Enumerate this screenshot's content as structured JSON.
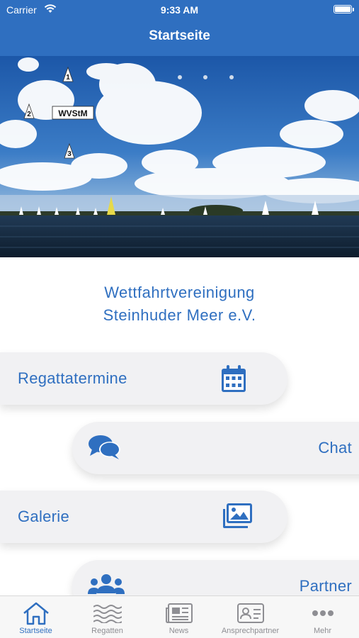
{
  "status_bar": {
    "carrier": "Carrier",
    "time": "9:33 AM"
  },
  "nav": {
    "title": "Startseite"
  },
  "hero": {
    "banner_label": "WVStM",
    "buoys": [
      "1",
      "2",
      "3"
    ]
  },
  "club": {
    "line1": "Wettfahrtvereinigung",
    "line2": "Steinhuder Meer e.V."
  },
  "menu": [
    {
      "label": "Regattatermine",
      "icon": "calendar-icon"
    },
    {
      "label": "Chat",
      "icon": "chat-bubbles-icon"
    },
    {
      "label": "Galerie",
      "icon": "images-icon"
    },
    {
      "label": "Partner",
      "icon": "users-icon"
    }
  ],
  "tabs": [
    {
      "label": "Startseite",
      "icon": "home-icon",
      "active": true
    },
    {
      "label": "Regatten",
      "icon": "waves-icon",
      "active": false
    },
    {
      "label": "News",
      "icon": "newspaper-icon",
      "active": false
    },
    {
      "label": "Ansprechpartner",
      "icon": "contact-card-icon",
      "active": false
    },
    {
      "label": "Mehr",
      "icon": "more-icon",
      "active": false
    }
  ],
  "colors": {
    "brand": "#2f6fc0",
    "tile_bg": "#f1f1f3",
    "tab_inactive": "#8e8e93"
  }
}
